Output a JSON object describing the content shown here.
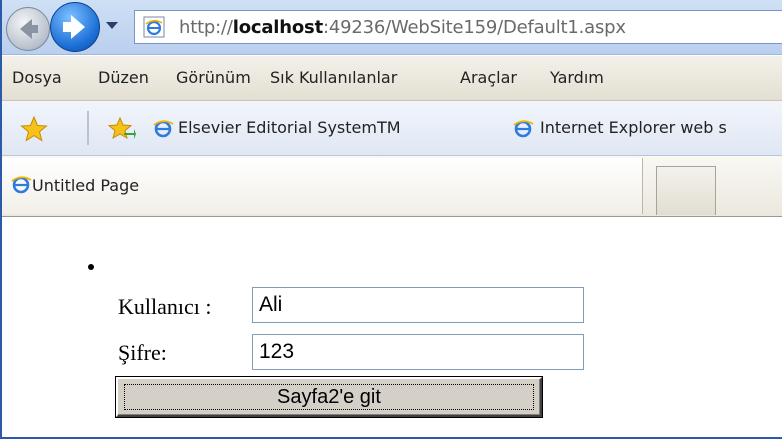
{
  "address_bar": {
    "url_prefix": "http://",
    "url_host": "localhost",
    "url_rest": ":49236/WebSite159/Default1.aspx"
  },
  "menu": {
    "items": [
      "Dosya",
      "Düzen",
      "Görünüm",
      "Sık Kullanılanlar",
      "Araçlar",
      "Yardım"
    ]
  },
  "favorites": {
    "links": [
      "Elsevier Editorial SystemTM",
      "Internet Explorer web s"
    ]
  },
  "tab": {
    "title": "Untitled Page"
  },
  "form": {
    "username_label": "Kullanıcı :",
    "username_value": "Ali",
    "password_label": "Şifre:",
    "password_value": "123",
    "submit_label": "Sayfa2'e git"
  },
  "colors": {
    "chrome_blue": "#2b5aa8",
    "button_face": "#d4d0c8"
  },
  "icons": {
    "back": "back-arrow-icon",
    "forward": "forward-arrow-icon",
    "dropdown": "chevron-down-icon",
    "page": "ie-page-icon",
    "favorites": "star-icon",
    "add_favorite": "add-favorite-icon"
  }
}
